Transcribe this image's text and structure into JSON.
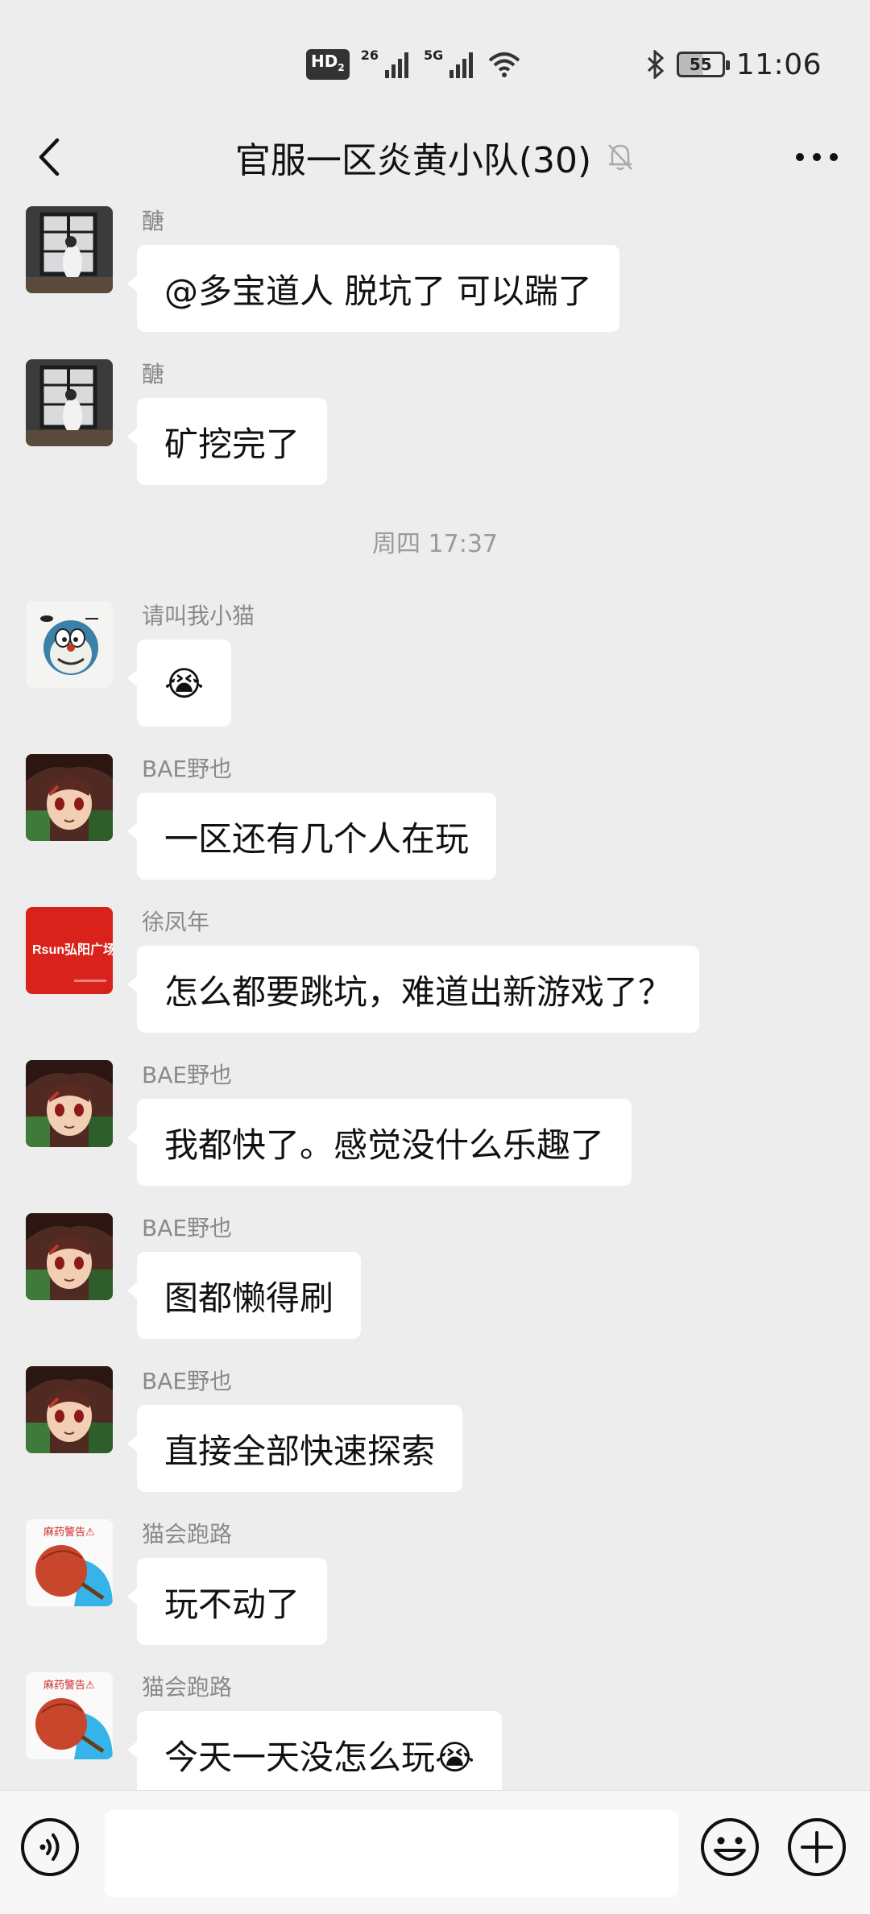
{
  "status_bar": {
    "hd": "HD",
    "hd_sub": "2",
    "sim1_label": "26",
    "sim2_label": "5G",
    "battery": "55",
    "time": "11:06"
  },
  "header": {
    "title": "官服一区炎黄小队(30)"
  },
  "timestamp": "周四 17:37",
  "messages": [
    {
      "sender": "醣",
      "text": "@多宝道人  脱坑了 可以踹了"
    },
    {
      "sender": "醣",
      "text": "矿挖完了"
    },
    {
      "sender": "请叫我小猫",
      "text": "😭"
    },
    {
      "sender": "BAE野也",
      "text": "一区还有几个人在玩"
    },
    {
      "sender": "徐凤年",
      "text": "怎么都要跳坑，难道出新游戏了？"
    },
    {
      "sender": "BAE野也",
      "text": "我都快了。感觉没什么乐趣了"
    },
    {
      "sender": "BAE野也",
      "text": "图都懒得刷"
    },
    {
      "sender": "BAE野也",
      "text": "直接全部快速探索"
    },
    {
      "sender": "猫会跑路",
      "text": "玩不动了"
    },
    {
      "sender": "猫会跑路",
      "text": "今天一天没怎么玩😭"
    }
  ],
  "avatars": {
    "rsun_text": "Rsun弘阳广场",
    "warning_text": "麻药警告⚠"
  },
  "colors": {
    "background": "#ededed",
    "bubble": "#ffffff",
    "secondary_text": "#8a8a8a"
  }
}
